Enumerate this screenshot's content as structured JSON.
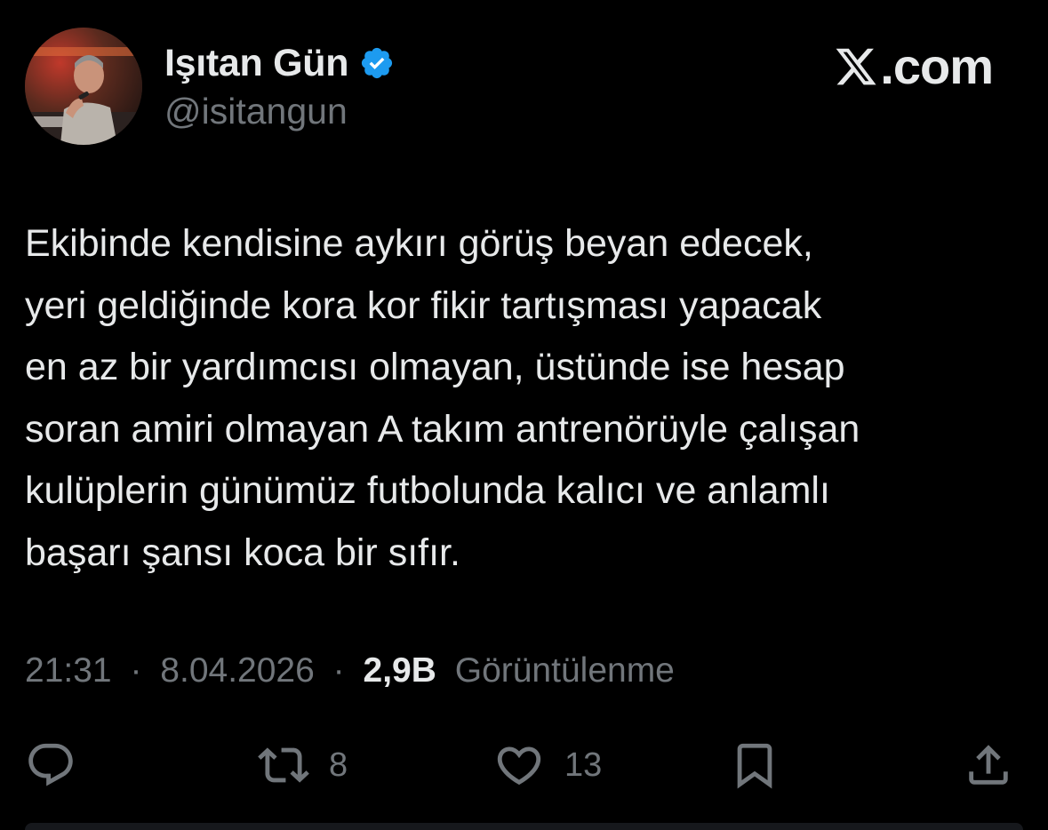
{
  "author": {
    "display_name": "Işıtan Gün",
    "handle": "@isitangun",
    "verified_icon": "verified-badge-icon",
    "avatar": "avatar-photo"
  },
  "brand": {
    "logo_icon": "x-logo-icon",
    "domain_text": ".com"
  },
  "tweet": {
    "text": "Ekibinde kendisine aykırı görüş beyan edecek,\nyeri geldiğinde kora kor fikir tartışması yapacak\nen az bir yardımcısı olmayan, üstünde ise hesap\nsoran amiri olmayan A takım antrenörüyle çalışan\nkulüplerin günümüz futbolunda kalıcı ve anlamlı\nbaşarı şansı koca bir sıfır."
  },
  "meta": {
    "time": "21:31",
    "separator": "·",
    "date": "8.04.2026",
    "views_count": "2,9B",
    "views_label": "Görüntülenme"
  },
  "actions": {
    "reply": {
      "icon": "reply-icon",
      "count": ""
    },
    "repost": {
      "icon": "repost-icon",
      "count": "8"
    },
    "like": {
      "icon": "heart-icon",
      "count": "13"
    },
    "bookmark": {
      "icon": "bookmark-icon",
      "count": ""
    },
    "share": {
      "icon": "share-icon",
      "count": ""
    }
  },
  "colors": {
    "background": "#000000",
    "text_primary": "#e7e9ea",
    "text_secondary": "#71767b",
    "verified_blue": "#1d9bf0"
  }
}
